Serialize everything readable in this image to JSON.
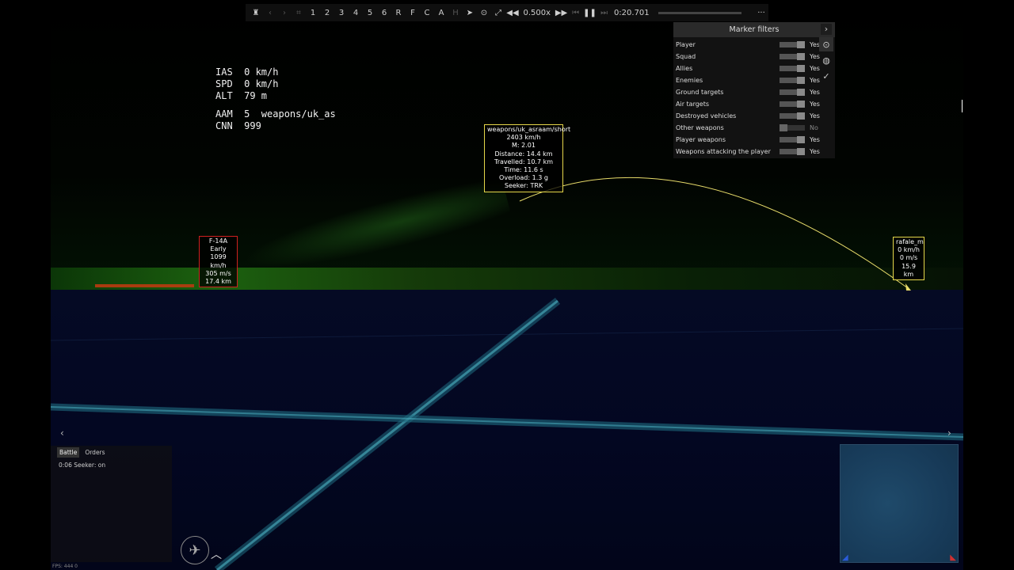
{
  "toolbar": {
    "frames": [
      "1",
      "2",
      "3",
      "4",
      "5",
      "6",
      "R",
      "F",
      "C",
      "A",
      "H"
    ],
    "speed": "0.500x",
    "time": "0:20.701",
    "more": "···"
  },
  "hud": {
    "ias": "IAS  0 km/h",
    "spd": "SPD  0 km/h",
    "alt": "ALT  79 m",
    "aam": "AAM  5  weapons/uk_as",
    "cnn": "CNN  999"
  },
  "missile_marker": {
    "name": "weapons/uk_asraam/short",
    "speed": "2403 km/h",
    "mach": "M: 2.01",
    "distance": "Distance: 14.4 km",
    "travelled": "Travelled: 10.7 km",
    "time": "Time: 11.6 s",
    "overload": "Overload: 1.3 g",
    "seeker": "Seeker: TRK"
  },
  "enemy_marker": {
    "name": "F-14A Early",
    "speed": "1099 km/h",
    "vspeed": "305 m/s",
    "distance": "17.4 km"
  },
  "rafale_marker": {
    "name": "rafale_m",
    "speed": "0 km/h",
    "vspeed": "0 m/s",
    "distance": "15.9 km"
  },
  "filters": {
    "title": "Marker filters",
    "items": [
      {
        "label": "Player",
        "value": "Yes"
      },
      {
        "label": "Squad",
        "value": "Yes"
      },
      {
        "label": "Allies",
        "value": "Yes"
      },
      {
        "label": "Enemies",
        "value": "Yes"
      },
      {
        "label": "Ground targets",
        "value": "Yes"
      },
      {
        "label": "Air targets",
        "value": "Yes"
      },
      {
        "label": "Destroyed vehicles",
        "value": "Yes"
      },
      {
        "label": "Other weapons",
        "value": "No"
      },
      {
        "label": "Player weapons",
        "value": "Yes"
      },
      {
        "label": "Weapons attacking the player",
        "value": "Yes"
      }
    ]
  },
  "chat": {
    "tab_battle": "Battle",
    "tab_orders": "Orders",
    "message": "0:06 Seeker: on"
  },
  "fps": "FPS: 444        0",
  "colors": {
    "missile_marker_border": "#e6d84a",
    "enemy_marker_border": "#d02020",
    "trajectory": "#e8dc6a"
  }
}
